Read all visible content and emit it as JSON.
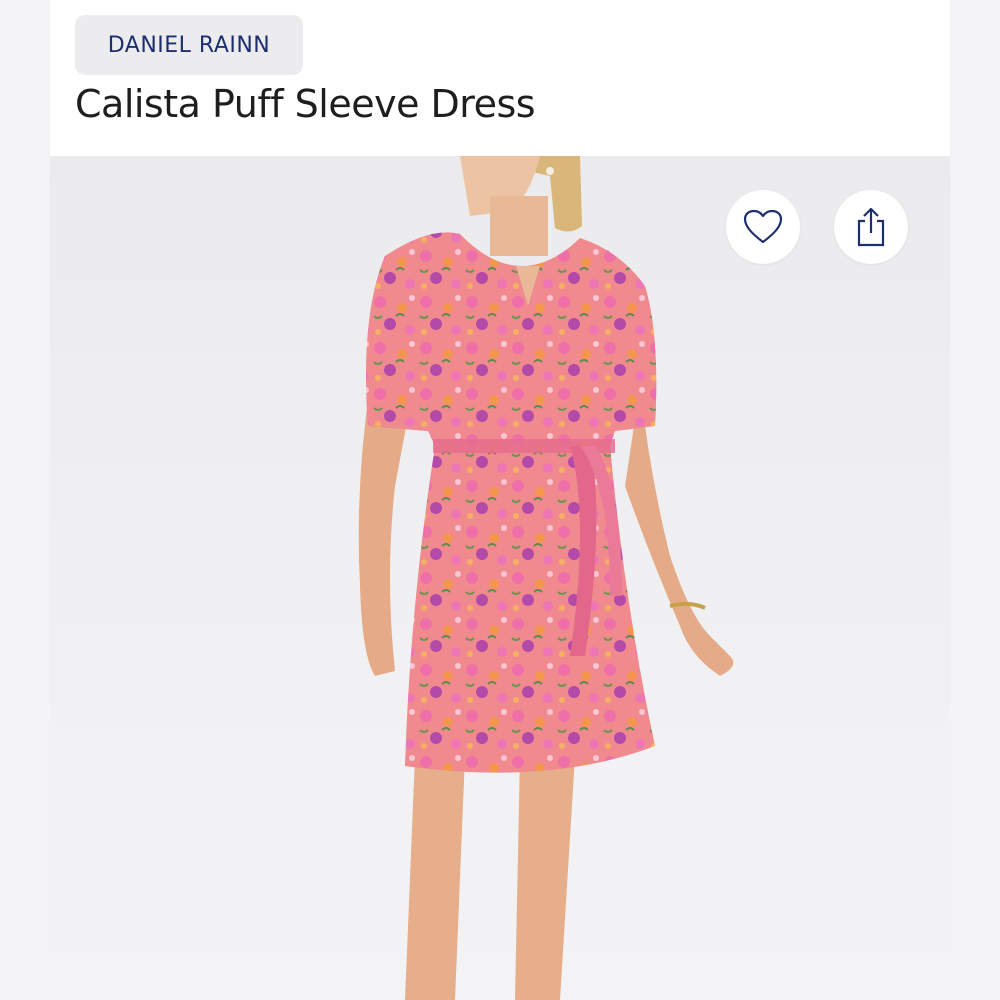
{
  "product": {
    "brand": "DANIEL RAINN",
    "title": "Calista Puff Sleeve Dress",
    "image": {
      "description_icon": "floral-dress-photo",
      "colors": {
        "dress_pink": "#ef7fa6",
        "dress_orange": "#ef8a5a",
        "dress_purple": "#b04aa8",
        "skin": "#e9b896",
        "hair": "#d9b67a"
      }
    }
  },
  "actions": {
    "favorite_icon": "heart-outline-icon",
    "share_icon": "share-icon"
  },
  "colors": {
    "brand_text": "#1d2f6f",
    "brand_pill_bg": "#ececef",
    "title_text": "#1e1e1e",
    "image_bg": "#efeff1"
  }
}
